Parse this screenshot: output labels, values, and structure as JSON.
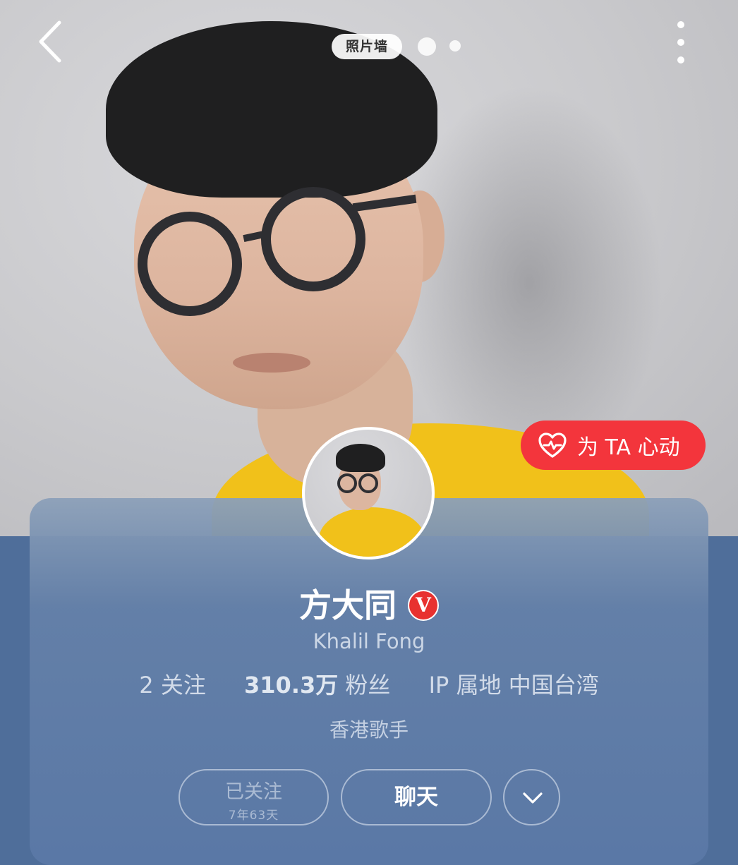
{
  "top_bar": {
    "page_tab_label": "照片墙",
    "page_indicator": {
      "count": 3,
      "current": 1
    }
  },
  "like_button": {
    "label": "为 TA 心动"
  },
  "profile": {
    "name": "方大同",
    "verified_badge": "V",
    "english_name": "Khalil Fong",
    "following": {
      "count": "2",
      "label": "关注"
    },
    "followers": {
      "count": "310.3万",
      "label": "粉丝"
    },
    "ip_location": {
      "label": "IP 属地",
      "value": "中国台湾"
    },
    "bio": "香港歌手"
  },
  "actions": {
    "follow": {
      "label": "已关注",
      "duration": "7年63天"
    },
    "chat": {
      "label": "聊天"
    }
  },
  "colors": {
    "accent_red": "#f3353c",
    "card_blue": "#5a78a6",
    "sweater_yellow": "#f1c11a"
  }
}
